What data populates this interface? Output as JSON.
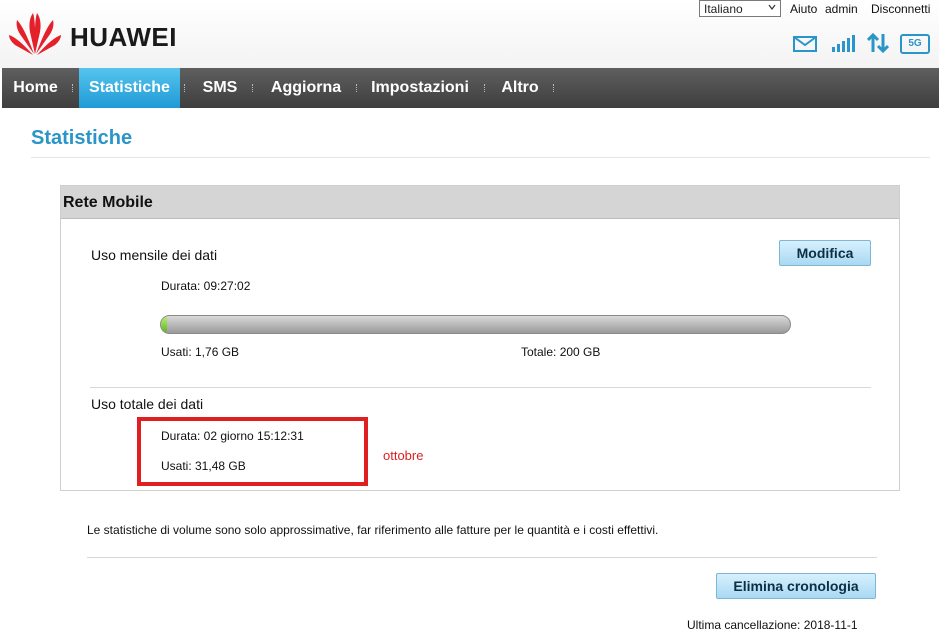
{
  "header": {
    "brand": "HUAWEI",
    "language": "Italiano",
    "help_label": "Aiuto",
    "user_label": "admin",
    "logout_label": "Disconnetti",
    "network_badge": "5G"
  },
  "nav": {
    "items": [
      "Home",
      "Statistiche",
      "SMS",
      "Aggiorna",
      "Impostazioni",
      "Altro"
    ],
    "active": "Statistiche"
  },
  "page": {
    "title": "Statistiche"
  },
  "panel": {
    "title": "Rete Mobile",
    "monthly": {
      "label": "Uso mensile dei dati",
      "edit_button": "Modifica",
      "duration": "Durata: 09:27:02",
      "used": "Usati: 1,76 GB",
      "total": "Totale: 200 GB",
      "usage_fraction": 0.0088
    },
    "total": {
      "label": "Uso totale dei dati",
      "duration": "Durata: 02 giorno 15:12:31",
      "used": "Usati: 31,48 GB"
    },
    "annotation": "ottobre"
  },
  "footer": {
    "note": "Le statistiche di volume sono solo approssimative, far riferimento alle fatture per le quantità e i costi effettivi.",
    "clear_button": "Elimina cronologia",
    "last_cleared": "Ultima cancellazione: 2018-11-1"
  },
  "colors": {
    "accent": "#2a95c8",
    "nav_bg": "#4a4a4a",
    "nav_active": "#2aa7e0",
    "annotation_red": "#e02020",
    "bar_fill": "#7ed12c"
  }
}
